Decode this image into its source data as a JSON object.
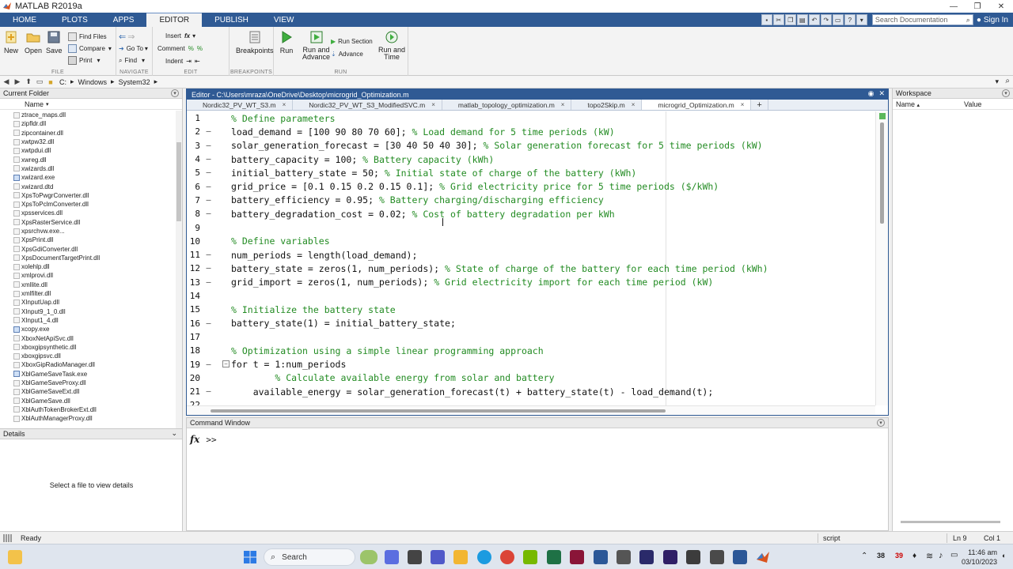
{
  "window": {
    "title": "MATLAB R2019a",
    "controls": [
      "—",
      "❐",
      "✕"
    ]
  },
  "ribbon_tabs": [
    {
      "label": "HOME"
    },
    {
      "label": "PLOTS"
    },
    {
      "label": "APPS"
    },
    {
      "label": "EDITOR"
    },
    {
      "label": "PUBLISH"
    },
    {
      "label": "VIEW"
    }
  ],
  "quick_access": {
    "search_placeholder": "Search Documentation",
    "sign_in": "Sign In"
  },
  "ribbon": {
    "groups": {
      "file": "FILE",
      "navigate": "NAVIGATE",
      "edit": "EDIT",
      "breakpoints": "BREAKPOINTS",
      "run": "RUN"
    },
    "buttons": {
      "new": "New",
      "open": "Open",
      "save": "Save",
      "find_files": "Find Files",
      "compare": "Compare",
      "print": "Print",
      "go_to": "Go To",
      "find": "Find",
      "insert": "Insert",
      "comment": "Comment",
      "indent": "Indent",
      "breakpoints": "Breakpoints",
      "run": "Run",
      "run_and_advance": "Run and\nAdvance",
      "run_section": "Run Section",
      "advance": "Advance",
      "run_and_time": "Run and\nTime"
    }
  },
  "address": {
    "parts": [
      "C:",
      "Windows",
      "System32"
    ]
  },
  "current_folder": {
    "title": "Current Folder",
    "column": "Name",
    "files": [
      {
        "name": "ztrace_maps.dll",
        "type": "dll"
      },
      {
        "name": "zipfldr.dll",
        "type": "dll"
      },
      {
        "name": "zipcontainer.dll",
        "type": "dll"
      },
      {
        "name": "xwtpw32.dll",
        "type": "dll"
      },
      {
        "name": "xwtpdui.dll",
        "type": "dll"
      },
      {
        "name": "xwreg.dll",
        "type": "dll"
      },
      {
        "name": "xwizards.dll",
        "type": "dll"
      },
      {
        "name": "xwizard.exe",
        "type": "exe"
      },
      {
        "name": "xwizard.dtd",
        "type": "dll"
      },
      {
        "name": "XpsToPwgrConverter.dll",
        "type": "dll"
      },
      {
        "name": "XpsToPclmConverter.dll",
        "type": "dll"
      },
      {
        "name": "xpsservices.dll",
        "type": "dll"
      },
      {
        "name": "XpsRasterService.dll",
        "type": "dll"
      },
      {
        "name": "xpsrchvw.exe...",
        "type": "dll"
      },
      {
        "name": "XpsPrint.dll",
        "type": "dll"
      },
      {
        "name": "XpsGdiConverter.dll",
        "type": "dll"
      },
      {
        "name": "XpsDocumentTargetPrint.dll",
        "type": "dll"
      },
      {
        "name": "xolehlp.dll",
        "type": "dll"
      },
      {
        "name": "xmlprovi.dll",
        "type": "dll"
      },
      {
        "name": "xmllite.dll",
        "type": "dll"
      },
      {
        "name": "xmlfilter.dll",
        "type": "dll"
      },
      {
        "name": "XInputUap.dll",
        "type": "dll"
      },
      {
        "name": "XInput9_1_0.dll",
        "type": "dll"
      },
      {
        "name": "XInput1_4.dll",
        "type": "dll"
      },
      {
        "name": "xcopy.exe",
        "type": "exe"
      },
      {
        "name": "XboxNetApiSvc.dll",
        "type": "dll"
      },
      {
        "name": "xboxgipsynthetic.dll",
        "type": "dll"
      },
      {
        "name": "xboxgipsvc.dll",
        "type": "dll"
      },
      {
        "name": "XboxGipRadioManager.dll",
        "type": "dll"
      },
      {
        "name": "XblGameSaveTask.exe",
        "type": "exe"
      },
      {
        "name": "XblGameSaveProxy.dll",
        "type": "dll"
      },
      {
        "name": "XblGameSaveExt.dll",
        "type": "dll"
      },
      {
        "name": "XblGameSave.dll",
        "type": "dll"
      },
      {
        "name": "XblAuthTokenBrokerExt.dll",
        "type": "dll"
      },
      {
        "name": "XblAuthManagerProxy.dll",
        "type": "dll"
      }
    ]
  },
  "details": {
    "title": "Details",
    "message": "Select a file to view details"
  },
  "editor": {
    "title": "Editor - C:\\Users\\mraza\\OneDrive\\Desktop\\microgrid_Optimization.m",
    "tabs": [
      {
        "label": "Nordic32_PV_WT_S3.m",
        "active": false
      },
      {
        "label": "Nordic32_PV_WT_S3_ModifiedSVC.m",
        "active": false
      },
      {
        "label": "matlab_topology_optimization.m",
        "active": false
      },
      {
        "label": "topo2Skip.m",
        "active": false
      },
      {
        "label": "microgrid_Optimization.m",
        "active": true
      }
    ],
    "add_tab": "+",
    "lines": [
      {
        "n": "1",
        "dash": "",
        "indent": "",
        "code": "",
        "comment": "% Define parameters"
      },
      {
        "n": "2",
        "dash": "—",
        "indent": "",
        "code": "load_demand = [100 90 80 70 60]; ",
        "comment": "% Load demand for 5 time periods (kW)"
      },
      {
        "n": "3",
        "dash": "—",
        "indent": "",
        "code": "solar_generation_forecast = [30 40 50 40 30]; ",
        "comment": "% Solar generation forecast for 5 time periods (kW)"
      },
      {
        "n": "4",
        "dash": "—",
        "indent": "",
        "code": "battery_capacity = 100; ",
        "comment": "% Battery capacity (kWh)"
      },
      {
        "n": "5",
        "dash": "—",
        "indent": "",
        "code": "initial_battery_state = 50; ",
        "comment": "% Initial state of charge of the battery (kWh)"
      },
      {
        "n": "6",
        "dash": "—",
        "indent": "",
        "code": "grid_price = [0.1 0.15 0.2 0.15 0.1]; ",
        "comment": "% Grid electricity price for 5 time periods ($/kWh)"
      },
      {
        "n": "7",
        "dash": "—",
        "indent": "",
        "code": "battery_efficiency = 0.95; ",
        "comment": "% Battery charging/discharging efficiency"
      },
      {
        "n": "8",
        "dash": "—",
        "indent": "",
        "code": "battery_degradation_cost = 0.02; ",
        "comment": "% Cost of battery degradation per kWh"
      },
      {
        "n": "9",
        "dash": "",
        "indent": "",
        "code": "",
        "comment": ""
      },
      {
        "n": "10",
        "dash": "",
        "indent": "",
        "code": "",
        "comment": "% Define variables"
      },
      {
        "n": "11",
        "dash": "—",
        "indent": "",
        "code": "num_periods = length(load_demand);",
        "comment": ""
      },
      {
        "n": "12",
        "dash": "—",
        "indent": "",
        "code": "battery_state = zeros(1, num_periods); ",
        "comment": "% State of charge of the battery for each time period (kWh)"
      },
      {
        "n": "13",
        "dash": "—",
        "indent": "",
        "code": "grid_import = zeros(1, num_periods); ",
        "comment": "% Grid electricity import for each time period (kW)"
      },
      {
        "n": "14",
        "dash": "",
        "indent": "",
        "code": "",
        "comment": ""
      },
      {
        "n": "15",
        "dash": "",
        "indent": "",
        "code": "",
        "comment": "% Initialize the battery state"
      },
      {
        "n": "16",
        "dash": "—",
        "indent": "",
        "code": "battery_state(1) = initial_battery_state;",
        "comment": ""
      },
      {
        "n": "17",
        "dash": "",
        "indent": "",
        "code": "",
        "comment": ""
      },
      {
        "n": "18",
        "dash": "",
        "indent": "",
        "code": "",
        "comment": "% Optimization using a simple linear programming approach"
      },
      {
        "n": "19",
        "dash": "—",
        "indent": "",
        "code": "for t = 1:num_periods",
        "comment": "",
        "fold": true
      },
      {
        "n": "20",
        "dash": "",
        "indent": "    ",
        "code": "",
        "comment": "% Calculate available energy from solar and battery"
      },
      {
        "n": "21",
        "dash": "—",
        "indent": "    ",
        "code": "available_energy = solar_generation_forecast(t) + battery_state(t) - load_demand(t);",
        "comment": ""
      },
      {
        "n": "22",
        "dash": "",
        "indent": "",
        "code": "",
        "comment": ""
      }
    ]
  },
  "command_window": {
    "title": "Command Window",
    "fx": "fx",
    "prompt": ">>"
  },
  "workspace": {
    "title": "Workspace",
    "col_name": "Name",
    "col_value": "Value"
  },
  "status": {
    "text": "Ready",
    "mode": "script",
    "ln": "Ln  9",
    "col": "Col  1"
  },
  "taskbar": {
    "search": "Search",
    "badges": [
      "38",
      "39"
    ],
    "time": "11:46 am",
    "date": "03/10/2023"
  },
  "colors": {
    "accent": "#2f5a94",
    "comment": "#228b22"
  }
}
